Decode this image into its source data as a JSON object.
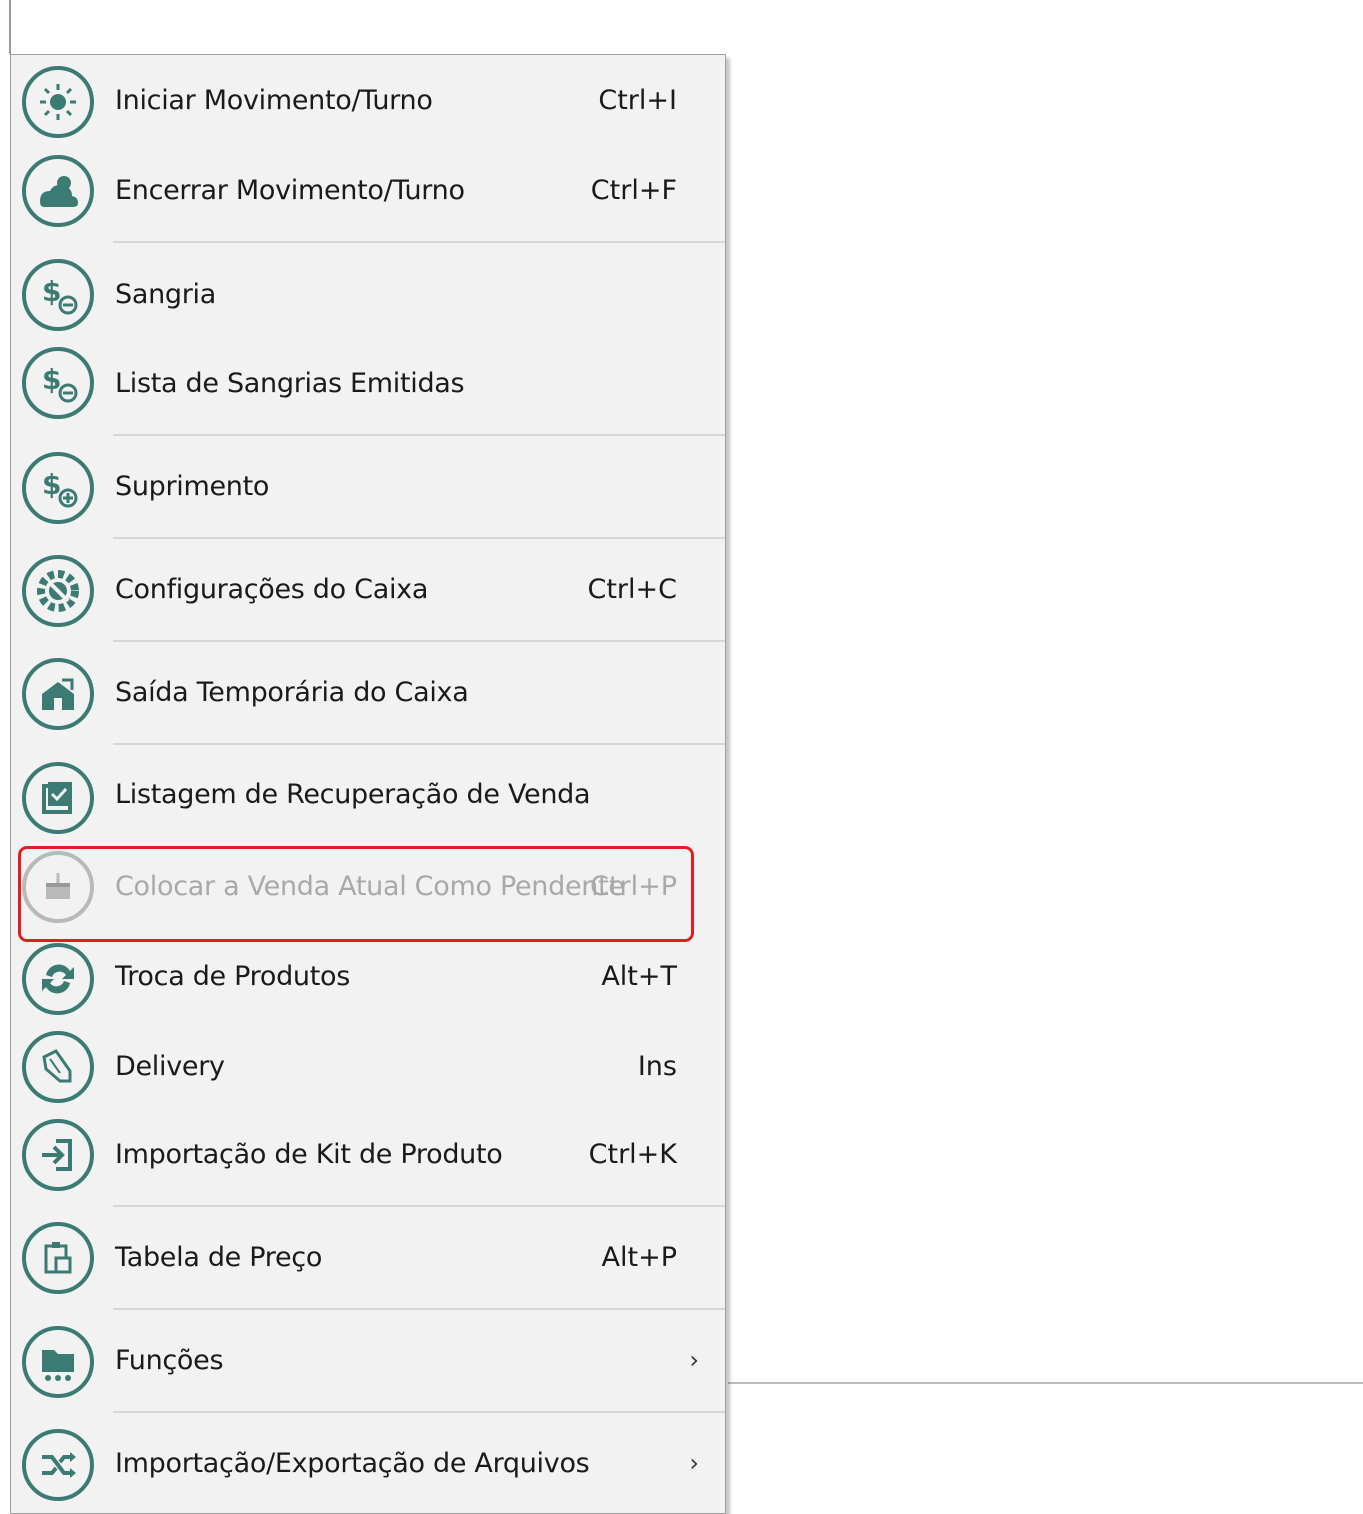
{
  "menu": {
    "items": [
      {
        "label": "Iniciar Movimento/Turno",
        "shortcut": "Ctrl+I",
        "icon": "sun-icon",
        "enabled": true
      },
      {
        "label": "Encerrar Movimento/Turno",
        "shortcut": "Ctrl+F",
        "icon": "cloud-sun-icon",
        "enabled": true
      },
      {
        "label": "Sangria",
        "shortcut": "",
        "icon": "dollar-minus-icon",
        "enabled": true
      },
      {
        "label": "Lista de Sangrias Emitidas",
        "shortcut": "",
        "icon": "dollar-minus-icon",
        "enabled": true
      },
      {
        "label": "Suprimento",
        "shortcut": "",
        "icon": "dollar-plus-icon",
        "enabled": true
      },
      {
        "label": "Configurações do Caixa",
        "shortcut": "Ctrl+C",
        "icon": "gear-wrench-icon",
        "enabled": true
      },
      {
        "label": "Saída Temporária do Caixa",
        "shortcut": "",
        "icon": "house-exit-icon",
        "enabled": true
      },
      {
        "label": "Listagem de Recuperação de Venda",
        "shortcut": "",
        "icon": "checklist-icon",
        "enabled": true
      },
      {
        "label": "Colocar a Venda Atual Como Pendente",
        "shortcut": "Ctrl+P",
        "icon": "basket-icon",
        "enabled": false
      },
      {
        "label": "Troca de Produtos",
        "shortcut": "Alt+T",
        "icon": "exchange-icon",
        "enabled": true
      },
      {
        "label": "Delivery",
        "shortcut": "Ins",
        "icon": "hand-card-icon",
        "enabled": true
      },
      {
        "label": "Importação de Kit de Produto",
        "shortcut": "Ctrl+K",
        "icon": "import-icon",
        "enabled": true
      },
      {
        "label": "Tabela de Preço",
        "shortcut": "Alt+P",
        "icon": "clipboard-icon",
        "enabled": true
      },
      {
        "label": "Funções",
        "shortcut": "",
        "icon": "folder-cart-icon",
        "enabled": true,
        "submenu": true
      },
      {
        "label": "Importação/Exportação de Arquivos",
        "shortcut": "",
        "icon": "shuffle-icon",
        "enabled": true,
        "submenu": true
      }
    ],
    "submenu_glyph": "›"
  },
  "colors": {
    "accent": "#3b7b73",
    "disabled": "#a9a9a9",
    "highlight": "#e02020",
    "menu_bg": "#f2f2f2"
  }
}
